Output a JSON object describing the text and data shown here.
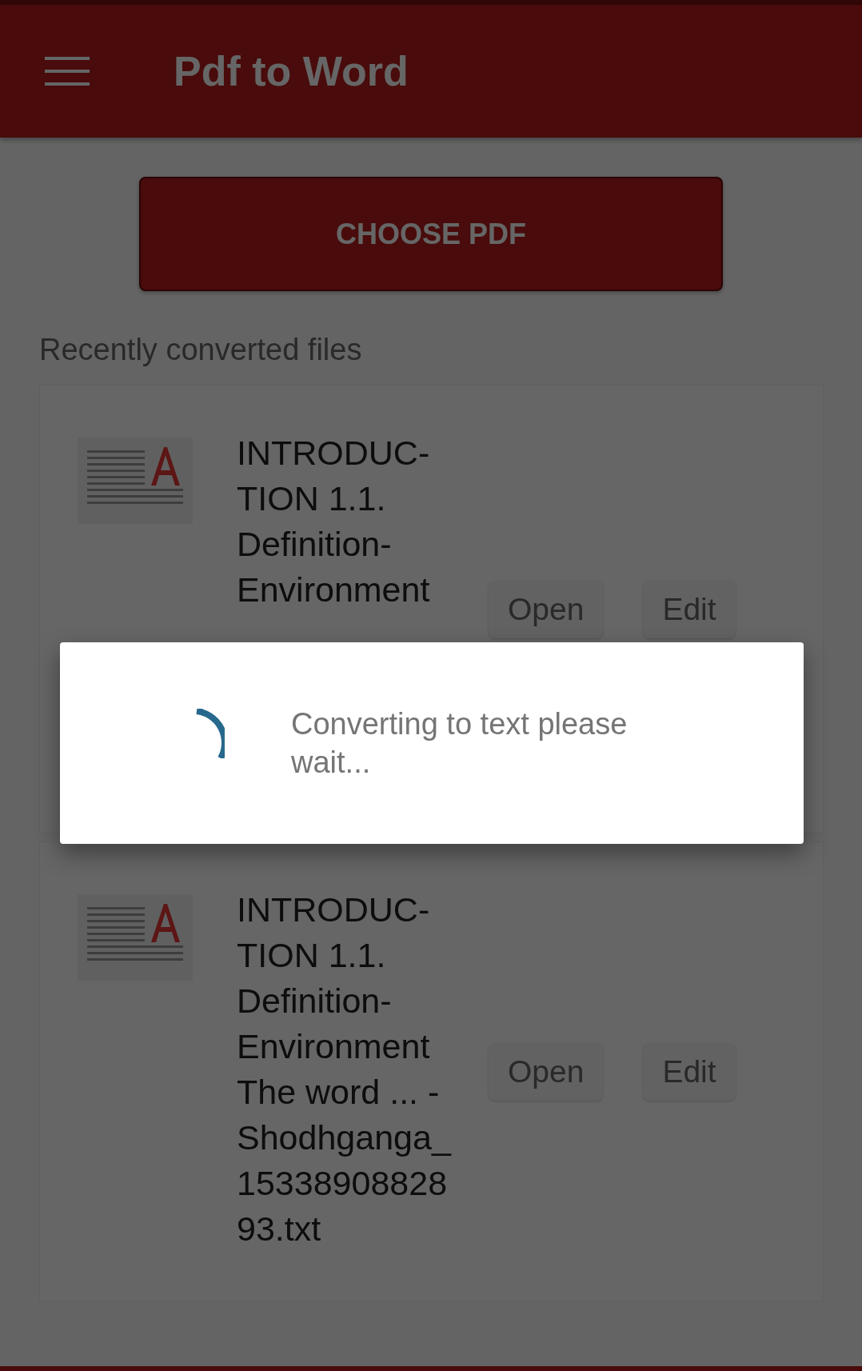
{
  "app_bar": {
    "title": "Pdf to Word"
  },
  "choose_button": "CHOOSE PDF",
  "section_title": "Recently converted files",
  "files": [
    {
      "title": "INTRODUC-\nTION 1.1.\nDefinition-\nEnvironment",
      "buttons": [
        "Open",
        "Edit"
      ]
    },
    {
      "title": "INTRODUC-\nTION 1.1.\nDefinition-\nEnvironment\nThe word ... -\nShodhganga_\n15338908828\n93.txt",
      "buttons": [
        "Open",
        "Edit"
      ]
    }
  ],
  "dialog": {
    "message": "Converting to text please wait..."
  }
}
